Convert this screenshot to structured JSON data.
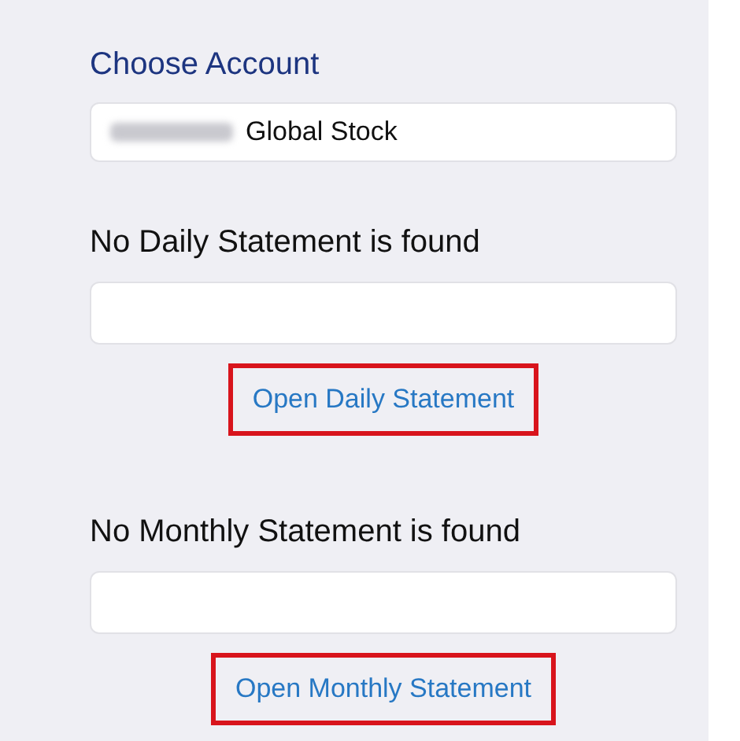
{
  "account": {
    "label": "Choose Account",
    "value": "Global Stock",
    "redacted_prefix": true
  },
  "sections": [
    {
      "message": "No Daily Statement is found",
      "action": "Open Daily Statement",
      "highlighted": true
    },
    {
      "message": "No Monthly Statement is found",
      "action": "Open Monthly Statement",
      "highlighted": true
    }
  ]
}
